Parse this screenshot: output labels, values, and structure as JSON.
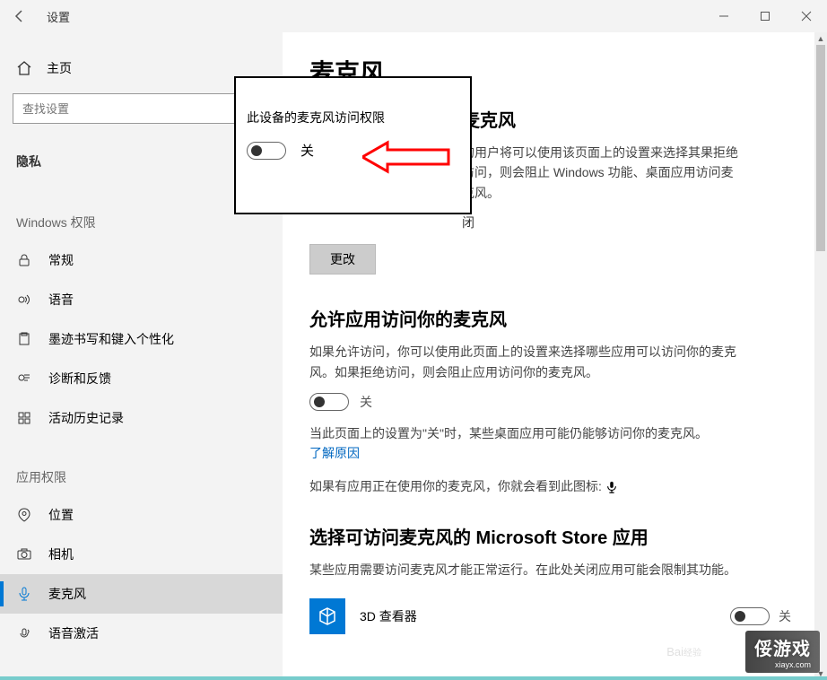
{
  "titlebar": {
    "title": "设置"
  },
  "sidebar": {
    "home": "主页",
    "search_placeholder": "查找设置",
    "group_privacy": "隐私",
    "group_win": "Windows 权限",
    "group_app": "应用权限",
    "items_win": [
      {
        "icon": "lock",
        "label": "常规"
      },
      {
        "icon": "speech",
        "label": "语音"
      },
      {
        "icon": "ink",
        "label": "墨迹书写和键入个性化"
      },
      {
        "icon": "diag",
        "label": "诊断和反馈"
      },
      {
        "icon": "history",
        "label": "活动历史记录"
      }
    ],
    "items_app": [
      {
        "icon": "location",
        "label": "位置"
      },
      {
        "icon": "camera",
        "label": "相机"
      },
      {
        "icon": "mic",
        "label": "麦克风",
        "selected": true
      },
      {
        "icon": "voice-act",
        "label": "语音激活"
      }
    ]
  },
  "main": {
    "page_title": "麦克风",
    "sec1_title": "麦克风",
    "sec1_body": "的用户将可以使用该页面上的设置来选择其果拒绝访问，则会阻止 Windows 功能、桌面应用访问麦克风。",
    "sec1_sub": "闭",
    "change_btn": "更改",
    "sec2_title": "允许应用访问你的麦克风",
    "sec2_body": "如果允许访问，你可以使用此页面上的设置来选择哪些应用可以访问你的麦克风。如果拒绝访问，则会阻止应用访问你的麦克风。",
    "off_label": "关",
    "sec2_note": "当此页面上的设置为\"关\"时，某些桌面应用可能仍能够访问你的麦克风。",
    "learn_why": "了解原因",
    "mic_in_use": "如果有应用正在使用你的麦克风，你就会看到此图标:",
    "sec3_title": "选择可访问麦克风的 Microsoft Store 应用",
    "sec3_body": "某些应用需要访问麦克风才能正常运行。在此处关闭应用可能会限制其功能。",
    "app1_name": "3D 查看器",
    "app1_state": "关"
  },
  "annotation": {
    "title": "此设备的麦克风访问权限",
    "state": "关"
  },
  "watermark": {
    "main": "俀游戏",
    "sub": "xiayx.com"
  }
}
